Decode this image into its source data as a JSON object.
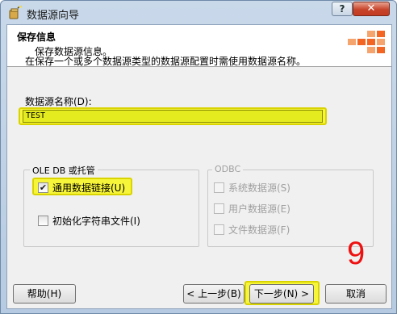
{
  "window": {
    "title": "数据源向导",
    "help_glyph": "?",
    "close_glyph": "✕"
  },
  "header": {
    "title": "保存信息",
    "subtitle": "保存数据源信息。"
  },
  "instruction": "在保存一个或多个数据源类型的数据源配置时需使用数据源名称。",
  "datasource": {
    "label": "数据源名称(D):",
    "value": "TEST"
  },
  "ole_group": {
    "legend": "OLE DB 或托管",
    "options": [
      {
        "label": "通用数据链接(U)",
        "checked": true,
        "enabled": true
      },
      {
        "label": "初始化字符串文件(I)",
        "checked": false,
        "enabled": true
      }
    ]
  },
  "odbc_group": {
    "legend": "ODBC",
    "options": [
      {
        "label": "系统数据源(S)",
        "checked": false,
        "enabled": false
      },
      {
        "label": "用户数据源(E)",
        "checked": false,
        "enabled": false
      },
      {
        "label": "文件数据源(F)",
        "checked": false,
        "enabled": false
      }
    ]
  },
  "buttons": {
    "help": "帮助(H)",
    "back": "< 上一步(B)",
    "next": "下一步(N) >",
    "cancel": "取消"
  },
  "annotation": "9",
  "colors": {
    "highlight": "#f7f53a",
    "annotation": "#ee1111",
    "logo_orange": "#f26522"
  },
  "icons": {
    "app": "wizard-icon",
    "header_logo": "orange-blocks-logo"
  }
}
